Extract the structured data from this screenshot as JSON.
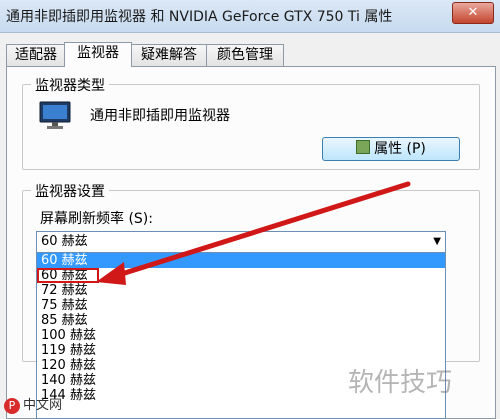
{
  "window": {
    "title": "通用非即插即用监视器 和 NVIDIA GeForce GTX 750 Ti 属性",
    "close_label": "✕"
  },
  "tabs": [
    {
      "label": "适配器"
    },
    {
      "label": "监视器"
    },
    {
      "label": "疑难解答"
    },
    {
      "label": "颜色管理"
    }
  ],
  "monitor_type": {
    "group_label": "监视器类型",
    "monitor_name": "通用非即插即用监视器",
    "properties_button": "属性 (P)",
    "icon": "monitor-icon"
  },
  "monitor_settings": {
    "group_label": "监视器设置",
    "refresh_label": "屏幕刷新频率 (S):",
    "selected_value": "60 赫兹",
    "options": [
      "60 赫兹",
      "60 赫兹",
      "72 赫兹",
      "75 赫兹",
      "85 赫兹",
      "100 赫兹",
      "119 赫兹",
      "120 赫兹",
      "140 赫兹",
      "144 赫兹"
    ]
  },
  "watermark": {
    "text": "软件技巧",
    "logo_text": "中文网",
    "logo_letter": "P"
  },
  "colors": {
    "highlight": "#3399ff",
    "annotation_red": "#d01818"
  }
}
